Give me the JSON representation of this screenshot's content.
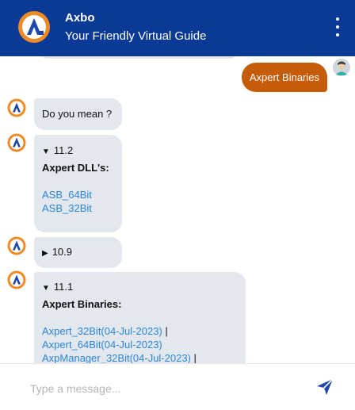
{
  "header": {
    "title": "Axbo",
    "subtitle": "Your Friendly Virtual Guide",
    "menu_icon": "more-vertical-icon",
    "brand_color": "#0a3a96"
  },
  "messages": {
    "user_message": "Axpert Binaries",
    "bot_did_you_mean": "Do you mean ?",
    "version_a": {
      "label": "11.2",
      "heading": "Axpert DLL's:",
      "links": [
        "ASB_64Bit",
        "ASB_32Bit"
      ]
    },
    "version_b": {
      "label": "10.9"
    },
    "version_c": {
      "label": "11.1",
      "heading": "Axpert Binaries:",
      "links": [
        "Axpert_32Bit(04-Jul-2023)",
        "Axpert_64Bit(04-Jul-2023)",
        "AxpManager_32Bit(04-Jul-2023)"
      ],
      "separator": "|"
    }
  },
  "composer": {
    "placeholder": "Type a message...",
    "send_icon": "send-icon"
  },
  "colors": {
    "user_bubble": "#c45c0a",
    "bot_bubble": "#e3e7ee",
    "link": "#2b86d6"
  }
}
